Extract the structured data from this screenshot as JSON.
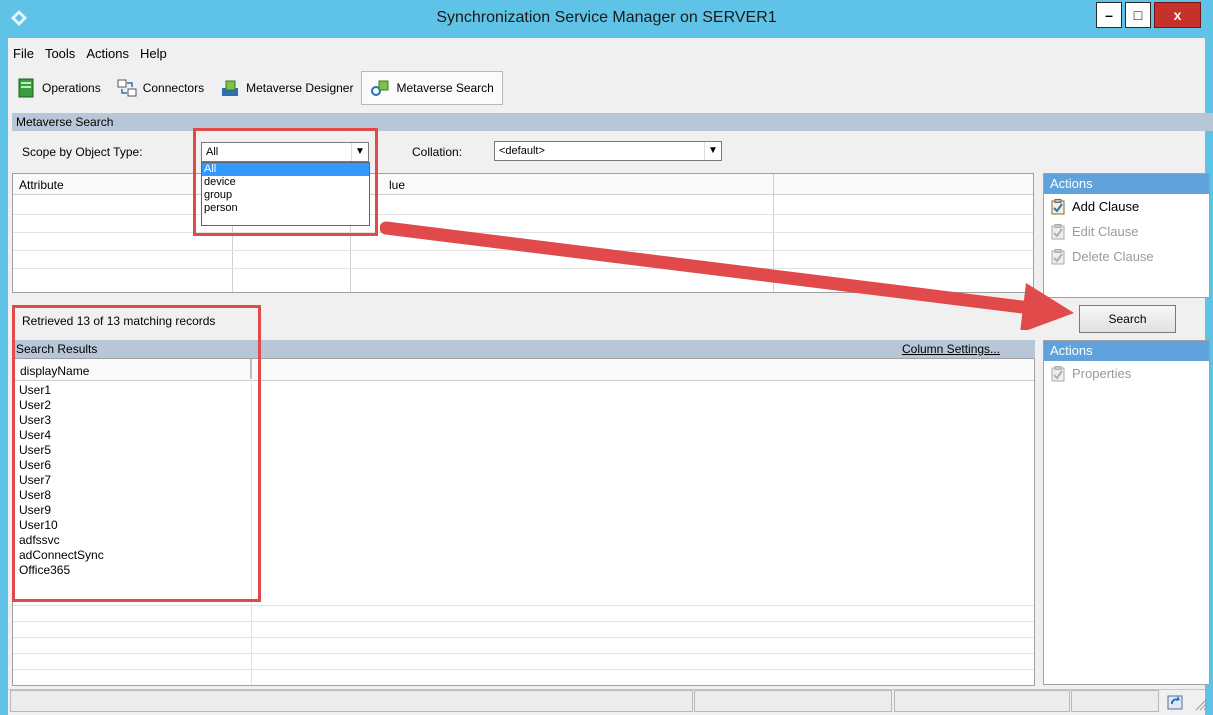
{
  "window": {
    "title": "Synchronization Service Manager on SERVER1",
    "min_glyph": "–",
    "max_glyph": "□",
    "close_glyph": "x"
  },
  "menu": [
    "File",
    "Tools",
    "Actions",
    "Help"
  ],
  "toolbar": {
    "operations": "Operations",
    "connectors": "Connectors",
    "metaverse_designer": "Metaverse Designer",
    "metaverse_search": "Metaverse Search"
  },
  "section": {
    "title": "Metaverse Search"
  },
  "scope": {
    "label": "Scope by Object Type:",
    "selected": "All",
    "options": [
      "All",
      "device",
      "group",
      "person"
    ]
  },
  "collation": {
    "label": "Collation:",
    "selected": "<default>"
  },
  "clause_grid": {
    "col_attribute": "Attribute",
    "col_value_partial": "lue"
  },
  "actions1": {
    "title": "Actions",
    "add_clause": "Add Clause",
    "edit_clause": "Edit Clause",
    "delete_clause": "Delete Clause"
  },
  "search_button": "Search",
  "status_text": "Retrieved 13 of 13 matching records",
  "results": {
    "title": "Search Results",
    "column_settings": "Column Settings...",
    "column": "displayName",
    "rows": [
      "User1",
      "User2",
      "User3",
      "User4",
      "User5",
      "User6",
      "User7",
      "User8",
      "User9",
      "User10",
      "adfssvc",
      "adConnectSync",
      "Office365"
    ]
  },
  "actions2": {
    "title": "Actions",
    "properties": "Properties"
  },
  "colors": {
    "title_bar": "#5fc3e8",
    "section_header": "#b8c7d8",
    "actions_header": "#5fa2dc",
    "highlight_red": "#e04a4a",
    "selection": "#3399ff"
  }
}
